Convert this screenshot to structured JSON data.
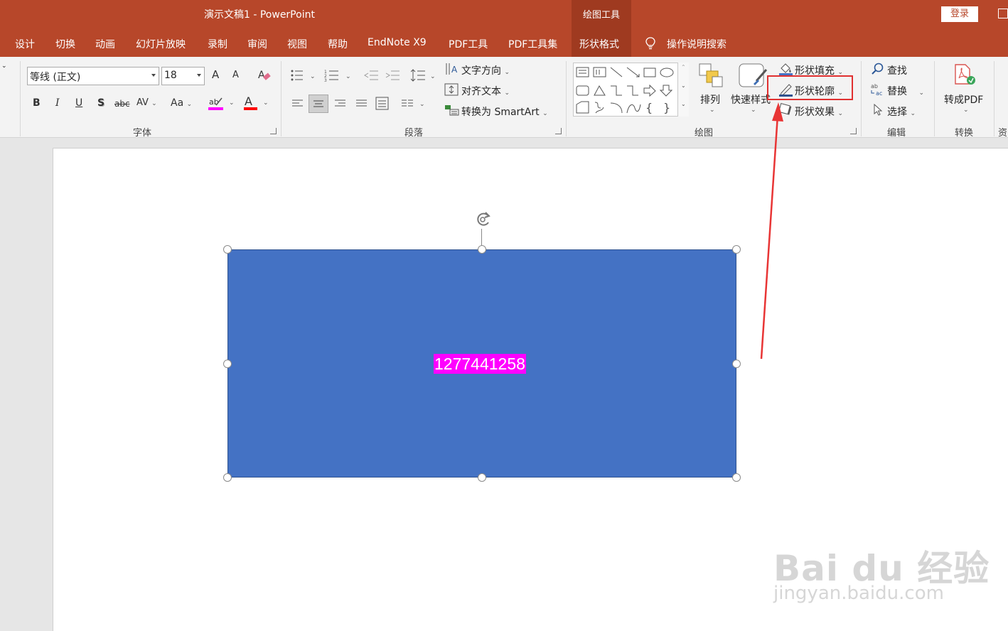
{
  "window": {
    "title": "演示文稿1  -  PowerPoint",
    "context_tab_header": "绘图工具",
    "login_label": "登录"
  },
  "tabs": [
    "设计",
    "切换",
    "动画",
    "幻灯片放映",
    "录制",
    "审阅",
    "视图",
    "帮助",
    "EndNote X9",
    "PDF工具",
    "PDF工具集",
    "形状格式"
  ],
  "active_tab": "形状格式",
  "tell_me": "操作说明搜索",
  "ribbon": {
    "font": {
      "name": "等线 (正文)",
      "size": "18",
      "bold": "B",
      "italic": "I",
      "underline": "U",
      "shadow": "S",
      "strike": "abc",
      "spacing": "AV",
      "case": "Aa",
      "grow": "A",
      "shrink": "A",
      "highlight_color": "#ff00ff",
      "font_color": "#ff0000",
      "label": "字体"
    },
    "paragraph": {
      "text_direction": "文字方向",
      "align_text": "对齐文本",
      "smartart": "转换为 SmartArt",
      "label": "段落"
    },
    "drawing": {
      "arrange": "排列",
      "quick_styles": "快速样式",
      "shape_fill": "形状填充",
      "shape_outline": "形状轮廓",
      "shape_effects": "形状效果",
      "label": "绘图"
    },
    "editing": {
      "find": "查找",
      "replace": "替换",
      "select": "选择",
      "label": "编辑"
    },
    "convert": {
      "to_pdf": "转成PDF",
      "label": "转换"
    },
    "cut_off_label": "资"
  },
  "slide": {
    "shape_text": "1277441258",
    "shape_fill": "#4472c4",
    "text_highlight": "#ff00ff"
  },
  "annotation": {
    "highlight_color": "#e03030",
    "arrow_color": "#e83535"
  },
  "watermark": {
    "main": "Bai du 经验",
    "sub": "jingyan.baidu.com"
  }
}
